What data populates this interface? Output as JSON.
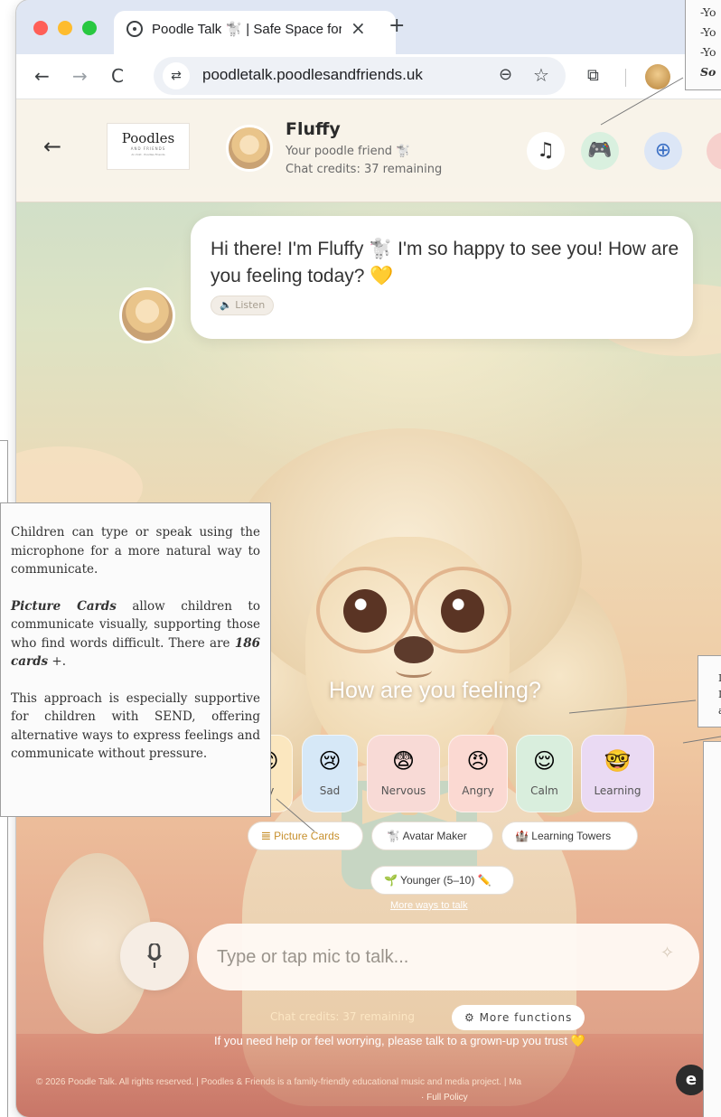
{
  "browser": {
    "tab_title": "Poodle Talk 🐩 | Safe Space for Children",
    "tab_close": "×",
    "new_tab": "+",
    "url": "poodletalk.poodlesandfriends.uk",
    "back_icon": "←",
    "forward_icon": "→",
    "reload_icon": "C",
    "site_info_icon": "⇄",
    "zoom_icon": "⊖",
    "bookmark_icon": "☆",
    "extensions_icon": "⧉"
  },
  "header": {
    "back_icon": "←",
    "logo_title": "Poodles",
    "logo_sub": "AND FRIENDS",
    "logo_tag": "AI child · Poodles Friends",
    "character_name": "Fluffy",
    "character_role": "Your poodle friend 🐩",
    "chat_credits": "Chat credits: 37 remaining",
    "music_icon": "♫",
    "game_icon": "🎮",
    "globe_icon": "⊕",
    "more_icon": "!"
  },
  "chat": {
    "greeting": "Hi there! I'm Fluffy 🐩 I'm so happy to see you! How are you feeling today? 💛",
    "listen_label": "🔈 Listen"
  },
  "moods": {
    "question": "How are you feeling?",
    "items": [
      {
        "emoji": "😊",
        "label": "py",
        "color": "#fbe7bf"
      },
      {
        "emoji": "😢",
        "label": "Sad",
        "color": "#d6e8f7"
      },
      {
        "emoji": "😨",
        "label": "Nervous",
        "color": "#f8dad6"
      },
      {
        "emoji": "😠",
        "label": "Angry",
        "color": "#fbd9d2"
      },
      {
        "emoji": "😌",
        "label": "Calm",
        "color": "#d9eedd"
      },
      {
        "emoji": "🤓",
        "label": "Learning",
        "color": "#eadaf3"
      }
    ]
  },
  "actions": {
    "picture_cards": "𝌆 Picture Cards",
    "avatar_maker": "🐩 Avatar Maker",
    "learning_towers": "🏰 Learning Towers",
    "younger": "🌱 Younger (5–10) ✏️",
    "more_ways": "More ways to talk"
  },
  "input": {
    "placeholder": "Type or tap mic to talk...",
    "mic_icon": "mic-icon",
    "sparkle_icon": "✧"
  },
  "footer": {
    "credits": "Chat credits: 37 remaining",
    "more_functions": "⚙ More functions",
    "help": "If you need help or feel worrying, please talk to a grown-up you trust 💛",
    "copyright": "© 2026 Poodle Talk. All rights reserved. | Poodles & Friends is a family-friendly educational music and media project. | Ma",
    "full_policy": "· Full Policy",
    "corner_badge": "e"
  },
  "annotations": {
    "main_p1": "Children can type or speak using the microphone for a more natural way to communicate.",
    "main_p2_em": "Picture Cards",
    "main_p2_a": " allow children to communicate visually, supporting those who find words difficult. There are ",
    "main_p2_em2": "186 cards",
    "main_p2_b": " +.",
    "main_p3": "This approach is especially supportive for children with SEND, offering alternative ways to express feelings and communicate without pressure.",
    "top_line1": "-Yo",
    "top_line2": "-Yo",
    "top_line3": "-Yo",
    "top_line4": "So",
    "mid_line1": "I",
    "mid_line2": "I",
    "mid_line3": "a"
  },
  "colors": {
    "accent_gold": "#c7902e",
    "game_green": "#2f9a55",
    "globe_blue": "#3a6fc4",
    "alert_red": "#d0453a"
  }
}
